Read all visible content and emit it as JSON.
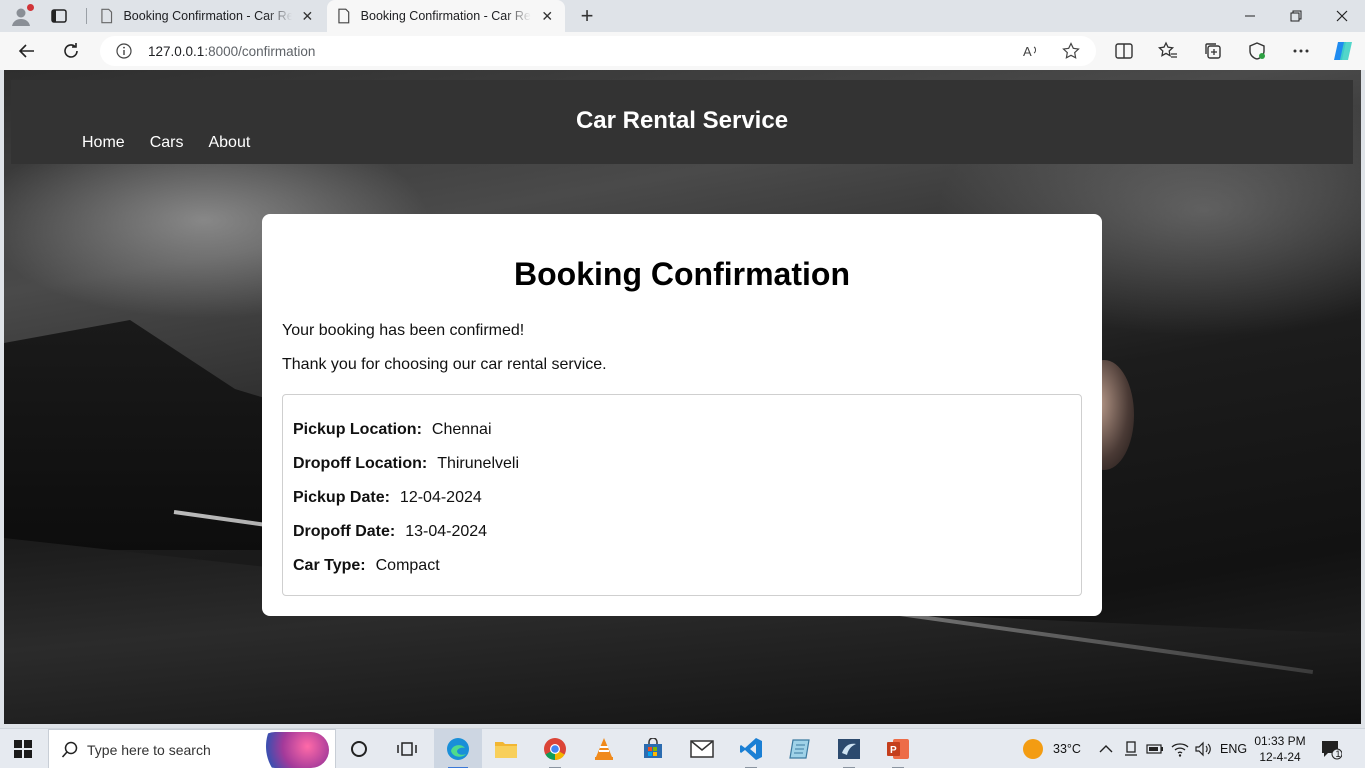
{
  "browser": {
    "tabs": [
      {
        "title": "Booking Confirmation - Car Rental Service",
        "active": false
      },
      {
        "title": "Booking Confirmation - Car Rental Service",
        "active": true
      }
    ],
    "url_host": "127.0.0.1",
    "url_path": ":8000/confirmation"
  },
  "site": {
    "title": "Car Rental Service",
    "nav": [
      "Home",
      "Cars",
      "About"
    ]
  },
  "confirmation": {
    "heading": "Booking Confirmation",
    "message": "Your booking has been confirmed!",
    "thanks": "Thank you for choosing our car rental service.",
    "details": [
      {
        "label": "Pickup Location:",
        "value": "Chennai"
      },
      {
        "label": "Dropoff Location:",
        "value": "Thirunelveli"
      },
      {
        "label": "Pickup Date:",
        "value": "12-04-2024"
      },
      {
        "label": "Dropoff Date:",
        "value": "13-04-2024"
      },
      {
        "label": "Car Type:",
        "value": "Compact"
      }
    ]
  },
  "taskbar": {
    "search_placeholder": "Type here to search",
    "weather": "33°C",
    "language": "ENG",
    "time": "01:33 PM",
    "date": "12-4-24",
    "notification_count": "1"
  },
  "colors": {
    "header_bg": "#333333",
    "accent": "#3a78d8"
  }
}
